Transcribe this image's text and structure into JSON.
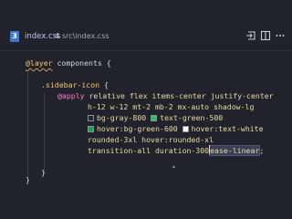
{
  "tab": {
    "icon_glyph": "3",
    "filename": "index.css",
    "problem_count": "4",
    "path": "src\\index.css",
    "actions": [
      "open-changes-icon",
      "split-editor-icon",
      "more-actions-icon"
    ]
  },
  "code": {
    "line1": {
      "keyword": "@layer",
      "rest": " components {"
    },
    "line3": {
      "selector": ".sidebar-icon",
      "rest": " {"
    },
    "line4": {
      "keyword": "@apply",
      "rest": " relative flex items-center justify-center"
    },
    "line5": {
      "text": "h-12 w-12 mt-2 mb-2 mx-auto shadow-lg"
    },
    "line6": {
      "a": "bg-gray-800",
      "b": "text-green-500"
    },
    "line7": {
      "a": "hover:bg-green-600",
      "b": "hover:text-white"
    },
    "line8": {
      "text": "rounded-3xl hover:rounded-xl"
    },
    "line9": {
      "before": "transition-all duration-300",
      "highlight": "ease-linear",
      "after": ";"
    },
    "line10": {
      "text": "}"
    },
    "line12": {
      "text": "}"
    }
  },
  "colors": {
    "background": "#21222c",
    "swatch_gray_800": "#1f2937",
    "swatch_green_500": "#22c55e",
    "swatch_green_600": "#16a34a",
    "swatch_white": "#ffffff",
    "keyword": "#ff79c6",
    "selector": "#f6c76b"
  }
}
